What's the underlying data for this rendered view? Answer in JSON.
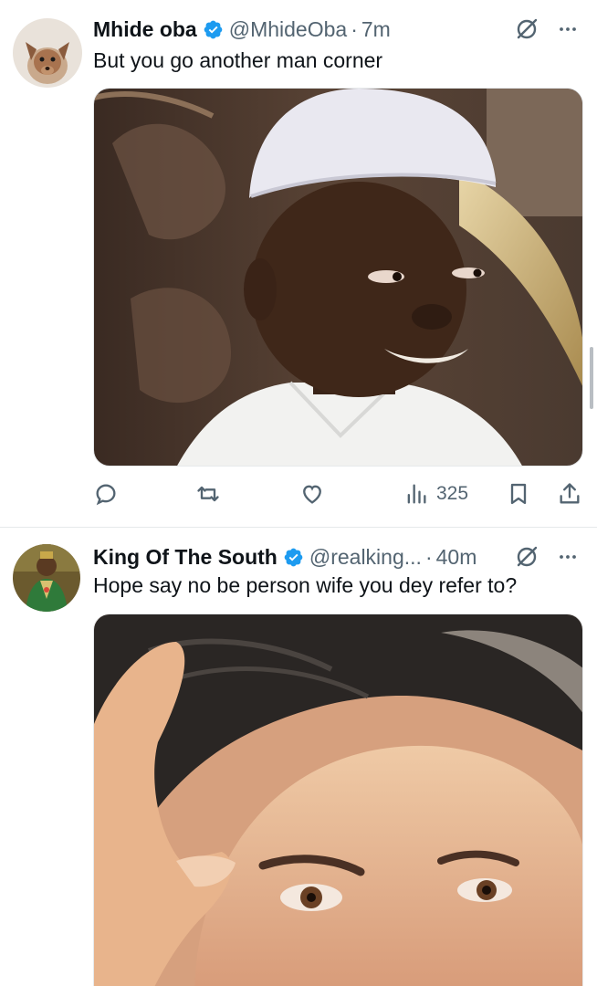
{
  "tweets": [
    {
      "display_name": "Mhide oba",
      "handle": "@MhideOba",
      "separator": "·",
      "time": "7m",
      "text": "But you go another man corner",
      "stats": {
        "views": "325"
      }
    },
    {
      "display_name": "King Of The South",
      "handle": "@realking...",
      "separator": "·",
      "time": "40m",
      "text": "Hope say no be person wife you dey refer to?"
    }
  ],
  "colors": {
    "text_primary": "#0f1419",
    "text_secondary": "#536471",
    "verified_blue": "#1d9bf0",
    "divider": "#e6e9eb"
  },
  "icons": {
    "verified": "verified-badge-icon",
    "grok": "grok-icon",
    "more": "more-dots-icon",
    "reply": "reply-icon",
    "retweet": "retweet-icon",
    "like": "heart-icon",
    "views": "views-chart-icon",
    "bookmark": "bookmark-icon",
    "share": "share-icon"
  }
}
